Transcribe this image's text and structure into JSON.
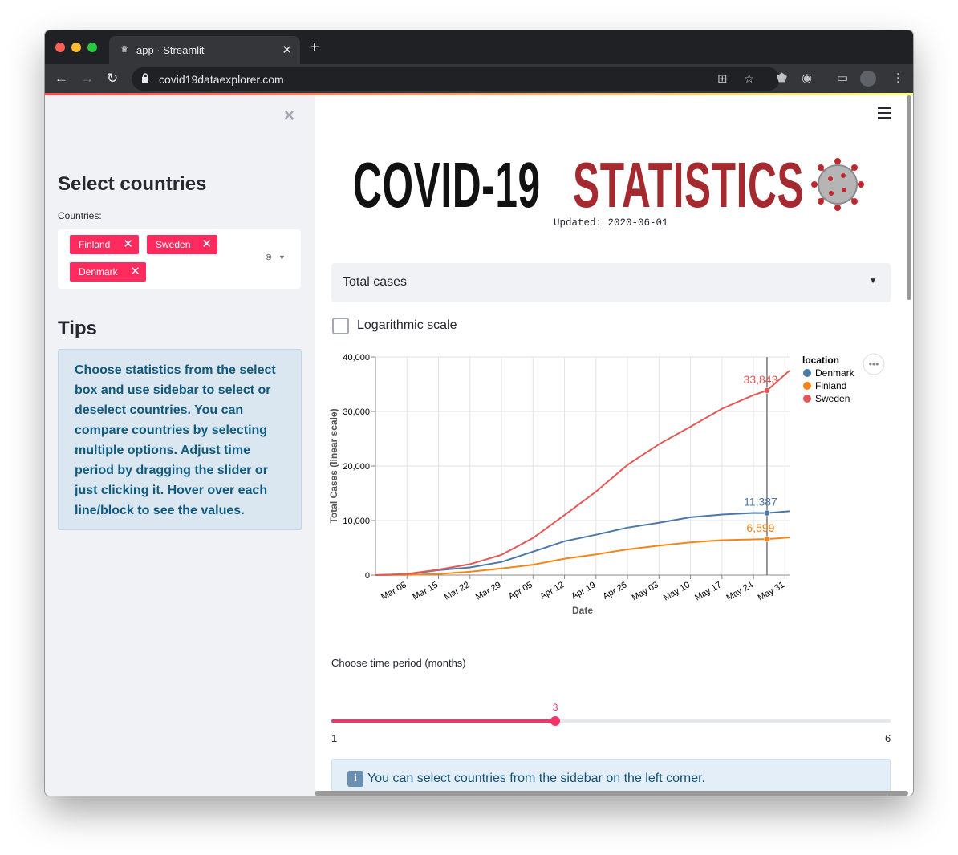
{
  "browser": {
    "tab_title": "app · Streamlit",
    "favicon": "crown-icon",
    "url": "covid19dataexplorer.com"
  },
  "sidebar": {
    "heading": "Select countries",
    "countries_label": "Countries:",
    "selected": [
      "Finland",
      "Sweden",
      "Denmark"
    ],
    "tips_heading": "Tips",
    "tips_text": "Choose statistics from the select box and use sidebar to select or deselect countries. You can compare countries by selecting multiple options. Adjust time period by dragging the slider or just clicking it. Hover over each line/block to see the values."
  },
  "main": {
    "logo_left": "COVID-19",
    "logo_right": "STATISTICS",
    "updated": "Updated: 2020-06-01",
    "statistic_select": "Total cases",
    "log_checkbox_label": "Logarithmic scale",
    "log_checked": false,
    "slider_label": "Choose time period (months)",
    "slider_value": 3,
    "slider_min": 1,
    "slider_max": 6,
    "info_text": "You can select countries from the sidebar on the left corner."
  },
  "colors": {
    "accent": "#ff2b5e",
    "denmark": "#4c78a8",
    "finland": "#f58518",
    "sweden": "#e45756"
  },
  "chart_data": {
    "type": "line",
    "xlabel": "Date",
    "ylabel": "Total Cases (linear scale)",
    "ylim": [
      0,
      40000
    ],
    "yticks": [
      "0",
      "10,000",
      "20,000",
      "30,000",
      "40,000"
    ],
    "xticks": [
      "Mar 08",
      "Mar 15",
      "Mar 22",
      "Mar 29",
      "Apr 05",
      "Apr 12",
      "Apr 19",
      "Apr 26",
      "May 03",
      "May 10",
      "May 17",
      "May 24",
      "May 31"
    ],
    "legend_title": "location",
    "legend_position": "top-right",
    "grid": true,
    "x": [
      "2020-03-01",
      "2020-03-08",
      "2020-03-15",
      "2020-03-22",
      "2020-03-29",
      "2020-04-05",
      "2020-04-12",
      "2020-04-19",
      "2020-04-26",
      "2020-05-03",
      "2020-05-10",
      "2020-05-17",
      "2020-05-24",
      "2020-05-27",
      "2020-06-01"
    ],
    "series": [
      {
        "name": "Denmark",
        "values": [
          0,
          150,
          900,
          1400,
          2400,
          4300,
          6200,
          7400,
          8700,
          9600,
          10600,
          11100,
          11400,
          11387,
          11700
        ]
      },
      {
        "name": "Finland",
        "values": [
          0,
          30,
          200,
          600,
          1200,
          1900,
          3000,
          3800,
          4700,
          5400,
          6000,
          6400,
          6550,
          6599,
          6900
        ]
      },
      {
        "name": "Sweden",
        "values": [
          0,
          200,
          1000,
          2000,
          3700,
          6800,
          11000,
          15300,
          20200,
          24000,
          27200,
          30500,
          33000,
          33843,
          37500
        ]
      }
    ],
    "hover": {
      "date": "2020-05-27",
      "labels": [
        "11,387",
        "6,599",
        "33,843"
      ]
    }
  }
}
